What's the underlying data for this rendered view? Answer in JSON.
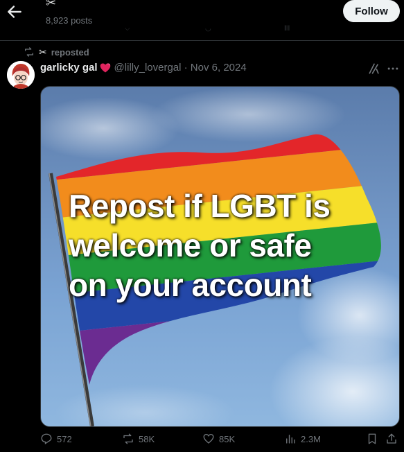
{
  "header": {
    "posts_count": "8,923 posts",
    "follow_label": "Follow"
  },
  "repost_banner": {
    "label": "reposted"
  },
  "post": {
    "display_name": "garlicky gal",
    "handle_date": "@lilly_lovergal · Nov 6, 2024",
    "image_text": {
      "line1": "Repost if LGBT is",
      "line2": "welcome or safe",
      "line3": "on your account"
    },
    "actions": {
      "replies": "572",
      "reposts": "58K",
      "likes": "85K",
      "views": "2.3M"
    }
  },
  "colors": {
    "background": "#000000",
    "muted_text": "#71767b",
    "follow_bg": "#eff3f4"
  },
  "icons": [
    "back-arrow-icon",
    "scissors-icon",
    "repost-icon",
    "heart-icon",
    "grok-icon",
    "more-icon",
    "reply-icon",
    "like-icon",
    "views-icon",
    "bookmark-icon",
    "share-icon"
  ]
}
